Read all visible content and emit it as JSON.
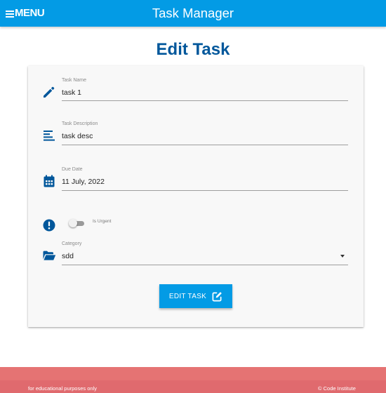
{
  "header": {
    "menu_label": "MENU",
    "brand": "Task Manager",
    "color": "#039be5"
  },
  "page_title": "Edit Task",
  "form": {
    "task_name": {
      "label": "Task Name",
      "value": "task 1",
      "icon": "pencil-icon"
    },
    "task_description": {
      "label": "Task Description",
      "value": "task desc",
      "icon": "align-left-icon"
    },
    "due_date": {
      "label": "Due Date",
      "value": "11 July, 2022",
      "icon": "calendar-icon"
    },
    "is_urgent": {
      "label": "Is Urgent",
      "checked": false,
      "icon": "exclamation-circle-icon"
    },
    "category": {
      "label": "Category",
      "value": "sdd",
      "icon": "folder-open-icon"
    },
    "submit": {
      "label": "EDIT TASK",
      "icon": "edit-icon"
    }
  },
  "footer": {
    "note": "for educational purposes only",
    "copyright": "© Code Institute",
    "color": "#e57373"
  },
  "colors": {
    "accent": "#039be5",
    "icon": "#01579b",
    "footer": "#e57373"
  }
}
